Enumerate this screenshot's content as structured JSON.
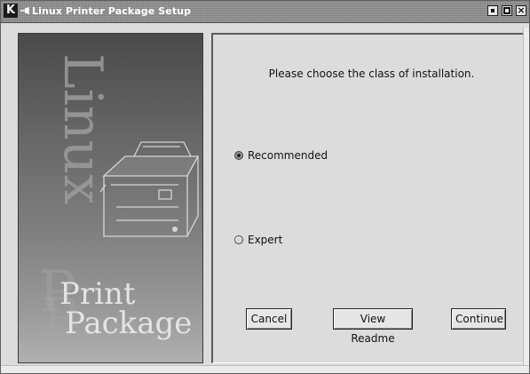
{
  "window": {
    "title": "Linux Printer Package Setup",
    "controls": [
      "minimize",
      "maximize",
      "close"
    ]
  },
  "banner": {
    "word_linux": "Linux",
    "word_print": "Print",
    "word_package": "Package"
  },
  "panel": {
    "prompt": "Please choose the class of installation.",
    "options": [
      {
        "label": "Recommended",
        "selected": true
      },
      {
        "label": "Expert",
        "selected": false
      }
    ],
    "buttons": {
      "cancel": "Cancel",
      "readme": "View Readme",
      "continue": "Continue"
    }
  },
  "icons": {
    "app": "k-logo-icon",
    "pin": "pushpin-icon",
    "close": "close-icon"
  },
  "colors": {
    "titlebar": "#8a8a8a",
    "background": "#dcdcdc",
    "banner_dark": "#4a4a4a",
    "banner_light": "#b0b0b0"
  }
}
